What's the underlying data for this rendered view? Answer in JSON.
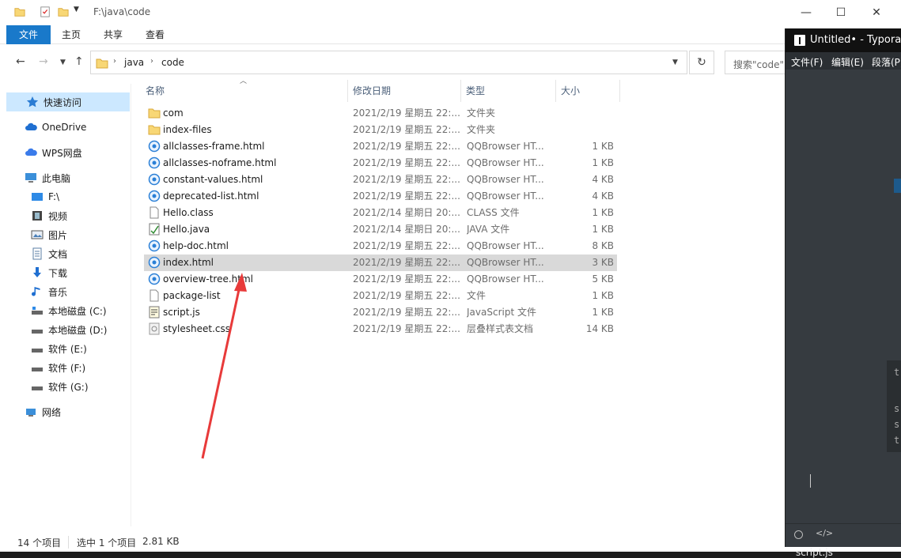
{
  "explorer": {
    "title_path": "F:\\java\\code",
    "window_buttons": {
      "minimize": "—",
      "maximize": "☐",
      "close": "✕"
    },
    "ribbon_tabs": [
      "文件",
      "主页",
      "共享",
      "查看"
    ],
    "address": {
      "crumbs": [
        "java",
        "code"
      ],
      "search_placeholder": "搜索\"code\""
    },
    "sidebar": [
      {
        "label": "快速访问",
        "icon": "star-icon"
      },
      {
        "label": "OneDrive",
        "icon": "cloud-icon"
      },
      {
        "label": "WPS网盘",
        "icon": "cloud-drive-icon"
      },
      {
        "label": "此电脑",
        "icon": "computer-icon"
      },
      {
        "label": "F:\\",
        "icon": "drive-icon"
      },
      {
        "label": "视频",
        "icon": "video-icon"
      },
      {
        "label": "图片",
        "icon": "picture-icon"
      },
      {
        "label": "文档",
        "icon": "document-icon"
      },
      {
        "label": "下载",
        "icon": "download-icon"
      },
      {
        "label": "音乐",
        "icon": "music-icon"
      },
      {
        "label": "本地磁盘 (C:)",
        "icon": "disk-icon"
      },
      {
        "label": "本地磁盘 (D:)",
        "icon": "disk-icon"
      },
      {
        "label": "软件 (E:)",
        "icon": "disk-icon"
      },
      {
        "label": "软件 (F:)",
        "icon": "disk-icon"
      },
      {
        "label": "软件 (G:)",
        "icon": "disk-icon"
      },
      {
        "label": "网络",
        "icon": "network-icon"
      }
    ],
    "columns": [
      "名称",
      "修改日期",
      "类型",
      "大小"
    ],
    "files": [
      {
        "name": "com",
        "date": "2021/2/19 星期五 22:...",
        "type": "文件夹",
        "size": "",
        "icon": "folder-icon"
      },
      {
        "name": "index-files",
        "date": "2021/2/19 星期五 22:...",
        "type": "文件夹",
        "size": "",
        "icon": "folder-icon"
      },
      {
        "name": "allclasses-frame.html",
        "date": "2021/2/19 星期五 22:...",
        "type": "QQBrowser HT...",
        "size": "1 KB",
        "icon": "browser-icon"
      },
      {
        "name": "allclasses-noframe.html",
        "date": "2021/2/19 星期五 22:...",
        "type": "QQBrowser HT...",
        "size": "1 KB",
        "icon": "browser-icon"
      },
      {
        "name": "constant-values.html",
        "date": "2021/2/19 星期五 22:...",
        "type": "QQBrowser HT...",
        "size": "4 KB",
        "icon": "browser-icon"
      },
      {
        "name": "deprecated-list.html",
        "date": "2021/2/19 星期五 22:...",
        "type": "QQBrowser HT...",
        "size": "4 KB",
        "icon": "browser-icon"
      },
      {
        "name": "Hello.class",
        "date": "2021/2/14 星期日 20:...",
        "type": "CLASS 文件",
        "size": "1 KB",
        "icon": "file-icon"
      },
      {
        "name": "Hello.java",
        "date": "2021/2/14 星期日 20:...",
        "type": "JAVA 文件",
        "size": "1 KB",
        "icon": "java-file-icon"
      },
      {
        "name": "help-doc.html",
        "date": "2021/2/19 星期五 22:...",
        "type": "QQBrowser HT...",
        "size": "8 KB",
        "icon": "browser-icon"
      },
      {
        "name": "index.html",
        "date": "2021/2/19 星期五 22:...",
        "type": "QQBrowser HT...",
        "size": "3 KB",
        "icon": "browser-icon",
        "selected": true
      },
      {
        "name": "overview-tree.html",
        "date": "2021/2/19 星期五 22:...",
        "type": "QQBrowser HT...",
        "size": "5 KB",
        "icon": "browser-icon"
      },
      {
        "name": "package-list",
        "date": "2021/2/19 星期五 22:...",
        "type": "文件",
        "size": "1 KB",
        "icon": "file-icon"
      },
      {
        "name": "script.js",
        "date": "2021/2/19 星期五 22:...",
        "type": "JavaScript 文件",
        "size": "1 KB",
        "icon": "script-icon"
      },
      {
        "name": "stylesheet.css",
        "date": "2021/2/19 星期五 22:...",
        "type": "层叠样式表文档",
        "size": "14 KB",
        "icon": "css-icon"
      }
    ],
    "status": {
      "count": "14 个项目",
      "selected": "选中 1 个项目",
      "size": "2.81 KB"
    },
    "accent_color": "#1979ca",
    "selection_color": "#d9d9d9"
  },
  "typora": {
    "title": "Untitled• - Typora",
    "menu": [
      "文件(F)",
      "编辑(E)",
      "段落(P)"
    ],
    "stray_chars": [
      "t",
      "s",
      "s",
      "t"
    ],
    "footer_code": "</>"
  },
  "taskbar": {
    "label": "script.js"
  },
  "annotation": {
    "color": "#e83a3a"
  }
}
